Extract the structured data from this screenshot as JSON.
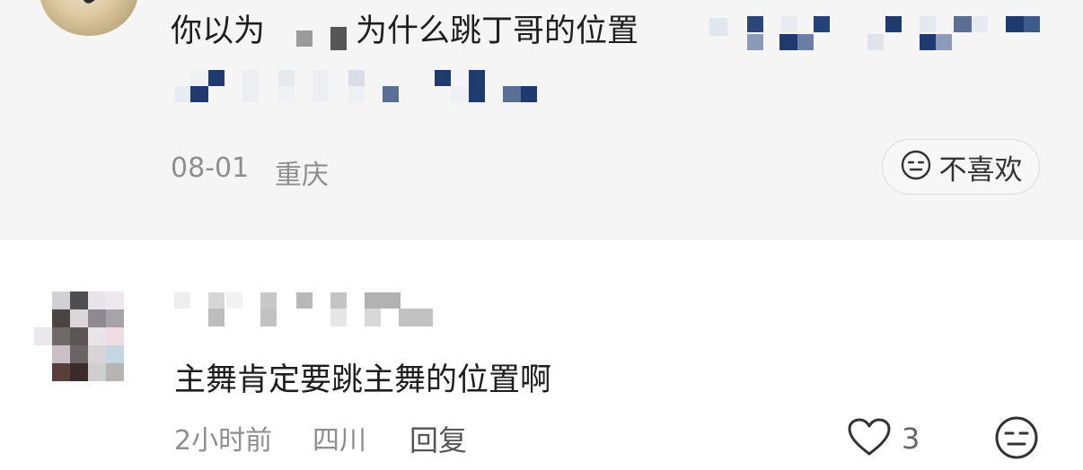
{
  "top_comment": {
    "text_prefix": "你以为",
    "text_main": "为什么跳丁哥的位置",
    "date": "08-01",
    "location": "重庆",
    "dislike_label": "不喜欢"
  },
  "reply": {
    "text": "主舞肯定要跳主舞的位置啊",
    "time": "2小时前",
    "location": "四川",
    "reply_label": "回复",
    "like_count": "3"
  },
  "colors": {
    "top_bg": "#f5f5f5",
    "censor_navy": "#1e3a6e",
    "censor_slate": "#5b6f95",
    "meta_gray": "#8e8e8e"
  }
}
